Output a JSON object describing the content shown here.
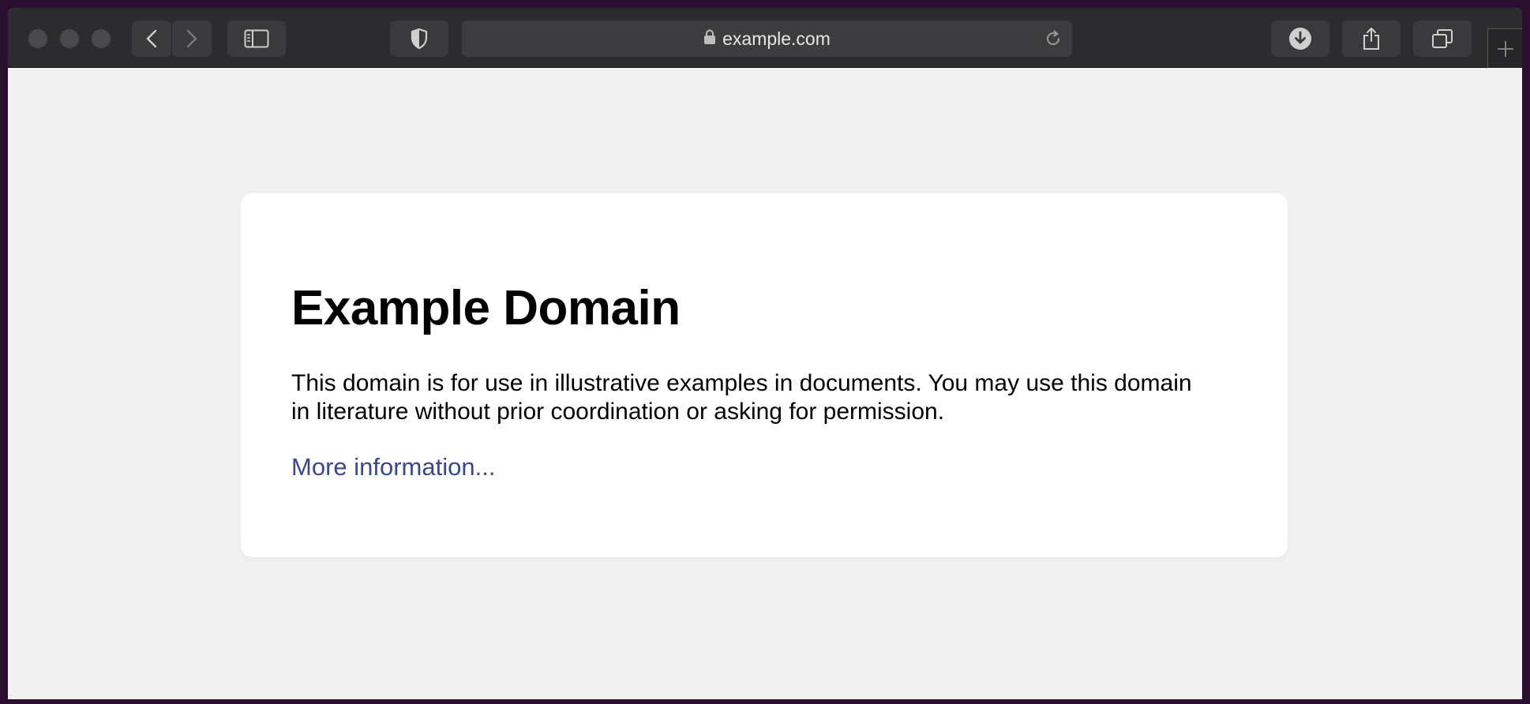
{
  "browser": {
    "url": "example.com",
    "icons": {
      "back": "chevron-left-icon",
      "forward": "chevron-right-icon",
      "sidebar": "sidebar-icon",
      "privacy": "shield-icon",
      "lock": "lock-icon",
      "reload": "reload-icon",
      "downloads": "download-icon",
      "share": "share-icon",
      "tabs": "tab-overview-icon",
      "new_tab": "plus-icon"
    }
  },
  "page": {
    "heading": "Example Domain",
    "body": "This domain is for use in illustrative examples in documents. You may use this domain in literature without prior coordination or asking for permission.",
    "link_text": "More information...",
    "colors": {
      "link": "#38488f",
      "background": "#f1f1f2",
      "card": "#ffffff"
    }
  }
}
